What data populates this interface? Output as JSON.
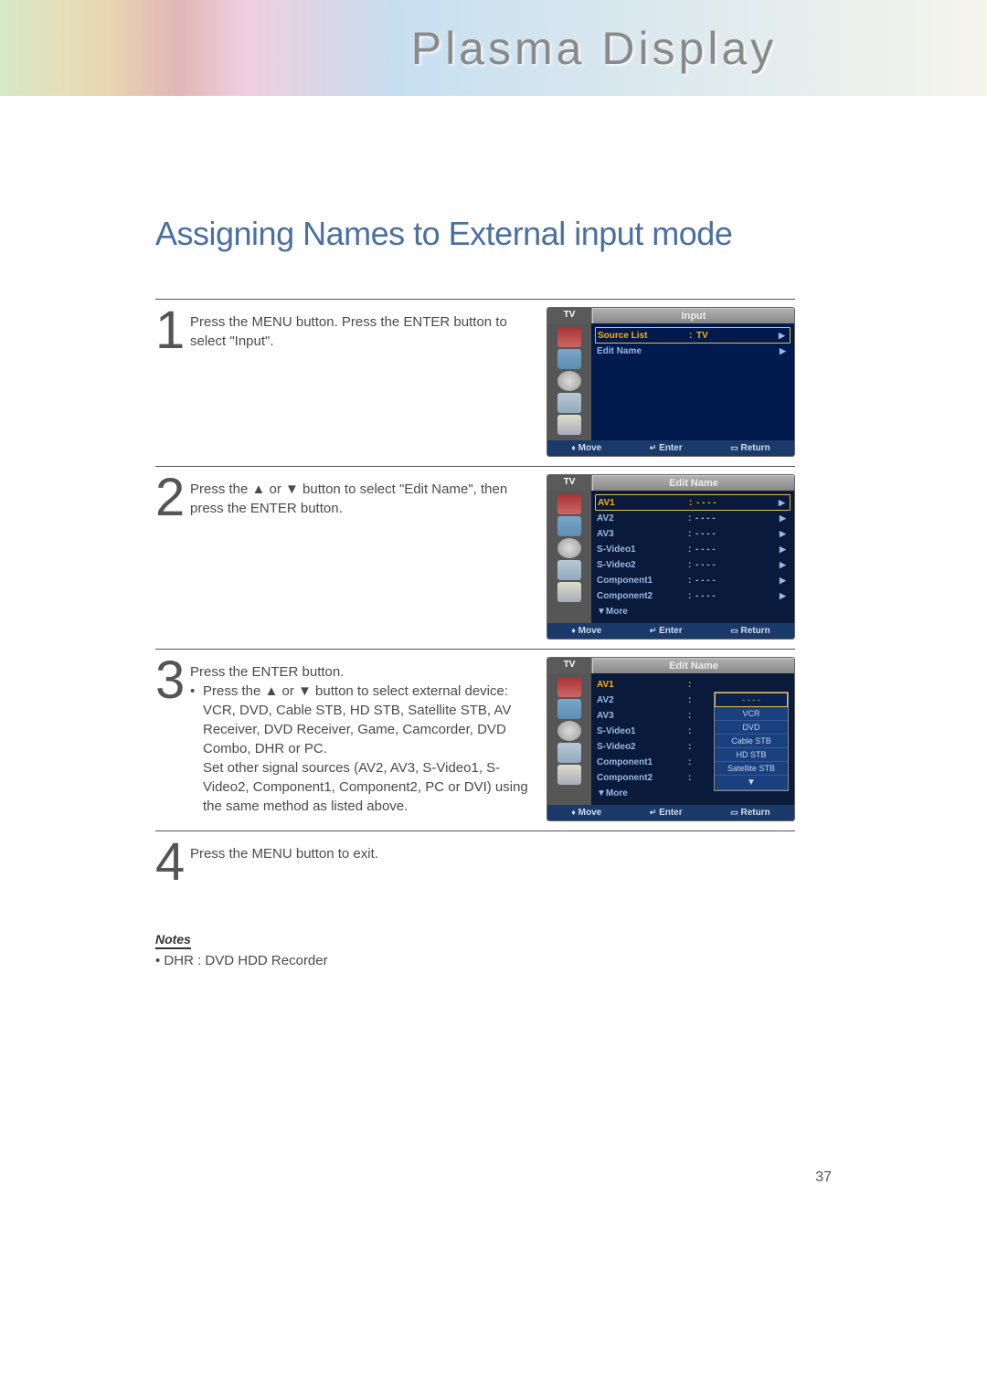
{
  "banner": {
    "title": "Plasma Display"
  },
  "page": {
    "title": "Assigning Names to External input mode",
    "number": "37"
  },
  "steps": {
    "s1": {
      "num": "1",
      "text": "Press the MENU button. Press the ENTER button to select \"Input\"."
    },
    "s2": {
      "num": "2",
      "text": "Press the ▲ or ▼ button to select \"Edit Name\", then press the ENTER button."
    },
    "s3": {
      "num": "3",
      "l1": "Press the ENTER button.",
      "l2": "Press the ▲ or ▼ button to select external device:",
      "l3": "VCR, DVD, Cable STB, HD STB, Satellite STB, AV Receiver, DVD Receiver, Game, Camcorder, DVD Combo, DHR or PC.",
      "l4": "Set other signal sources (AV2, AV3, S-Video1, S-Video2, Component1, Component2, PC or DVI) using the same method as listed above."
    },
    "s4": {
      "num": "4",
      "text": "Press the MENU button to exit."
    }
  },
  "osd": {
    "tv": "TV",
    "titles": {
      "input": "Input",
      "edit": "Edit Name"
    },
    "panel1": {
      "r1": {
        "lab": "Source List",
        "val": "TV"
      },
      "r2": {
        "lab": "Edit Name"
      }
    },
    "panel2": {
      "r1": "AV1",
      "r2": "AV2",
      "r3": "AV3",
      "r4": "S-Video1",
      "r5": "S-Video2",
      "r6": "Component1",
      "r7": "Component2",
      "more": "▼More",
      "dash": "- - - -"
    },
    "panel3": {
      "r1": "AV1",
      "r2": "AV2",
      "r3": "AV3",
      "r4": "S-Video1",
      "r5": "S-Video2",
      "r6": "Component1",
      "r7": "Component2",
      "more": "▼More",
      "drop": {
        "blank": "- - - -",
        "d1": "VCR",
        "d2": "DVD",
        "d3": "Cable STB",
        "d4": "HD STB",
        "d5": "Satellite STB",
        "dm": "▼"
      }
    },
    "footer": {
      "move": "Move",
      "enter": "Enter",
      "return": "Return"
    }
  },
  "notes": {
    "title": "Notes",
    "n1": "DHR : DVD HDD Recorder"
  }
}
